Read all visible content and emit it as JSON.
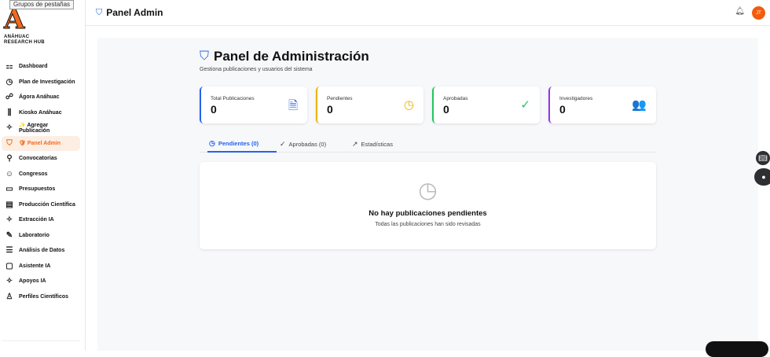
{
  "tooltip": "Grupos de pestañas",
  "brand": {
    "letter": "A",
    "line1": "ANÁHUAC",
    "line2": "RESEARCH HUB"
  },
  "sidebar": {
    "items": [
      {
        "label": "Dashboard",
        "icon": "⚏"
      },
      {
        "label": "Plan de Investigación",
        "icon": "◷"
      },
      {
        "label": "Ágora Anáhuac",
        "icon": "☍"
      },
      {
        "label": "Kiosko Anáhuac",
        "icon": "⫼"
      },
      {
        "label": "✨ Agregar Publicación",
        "icon": "✧"
      },
      {
        "label": "🛡 Panel Admin",
        "icon": "⛉"
      },
      {
        "label": "Convocatorias",
        "icon": "⚲"
      },
      {
        "label": "Congresos",
        "icon": "☺"
      },
      {
        "label": "Presupuestos",
        "icon": "▭"
      },
      {
        "label": "Producción Científica",
        "icon": "▤"
      },
      {
        "label": "Extracción IA",
        "icon": "✧"
      },
      {
        "label": "Laboratorio",
        "icon": "✎"
      },
      {
        "label": "Análisis de Datos",
        "icon": "☰"
      },
      {
        "label": "Asistente IA",
        "icon": "▢"
      },
      {
        "label": "Apoyos IA",
        "icon": "✧"
      },
      {
        "label": "Perfiles Científicos",
        "icon": "♙"
      }
    ]
  },
  "header": {
    "title": "Panel Admin",
    "avatar": "JT"
  },
  "page": {
    "title": "Panel de Administración",
    "subtitle": "Gestiona publicaciones y usuarios del sistema"
  },
  "stats": [
    {
      "label": "Total Publicaciones",
      "value": "0",
      "color": "#2563eb",
      "icon": "🗎"
    },
    {
      "label": "Pendientes",
      "value": "0",
      "color": "#eab308",
      "icon": "◷"
    },
    {
      "label": "Aprobadas",
      "value": "0",
      "color": "#22c55e",
      "icon": "✓"
    },
    {
      "label": "Investigadores",
      "value": "0",
      "color": "#9333ea",
      "icon": "👥"
    }
  ],
  "tabs": [
    {
      "label": "Pendientes (0)"
    },
    {
      "label": "Aprobadas (0)"
    },
    {
      "label": "Estadísticas"
    }
  ],
  "empty": {
    "title": "No hay publicaciones pendientes",
    "subtitle": "Todas las publicaciones han sido revisadas"
  }
}
